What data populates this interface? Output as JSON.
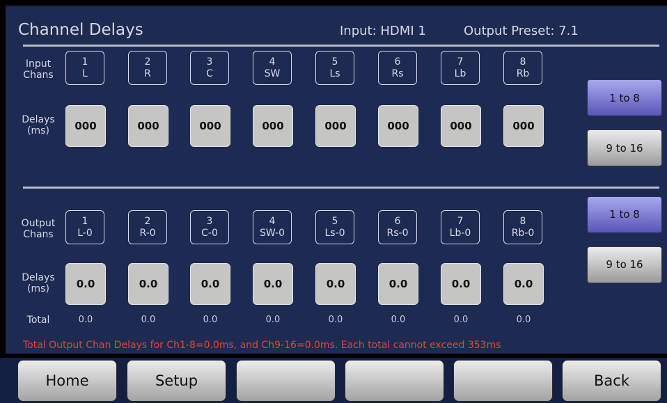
{
  "header": {
    "title": "Channel Delays",
    "input": "Input: HDMI 1",
    "output_preset": "Output Preset: 7.1"
  },
  "input_section": {
    "chans_label_1": "Input",
    "chans_label_2": "Chans",
    "delays_label_1": "Delays",
    "delays_label_2": "(ms)",
    "channels": [
      {
        "num": "1",
        "name": "L",
        "delay": "000"
      },
      {
        "num": "2",
        "name": "R",
        "delay": "000"
      },
      {
        "num": "3",
        "name": "C",
        "delay": "000"
      },
      {
        "num": "4",
        "name": "SW",
        "delay": "000"
      },
      {
        "num": "5",
        "name": "Ls",
        "delay": "000"
      },
      {
        "num": "6",
        "name": "Rs",
        "delay": "000"
      },
      {
        "num": "7",
        "name": "Lb",
        "delay": "000"
      },
      {
        "num": "8",
        "name": "Rb",
        "delay": "000"
      }
    ],
    "range_buttons": {
      "first": "1 to 8",
      "second": "9 to 16"
    }
  },
  "output_section": {
    "chans_label_1": "Output",
    "chans_label_2": "Chans",
    "delays_label_1": "Delays",
    "delays_label_2": "(ms)",
    "total_label": "Total",
    "channels": [
      {
        "num": "1",
        "name": "L-0",
        "delay": "0.0",
        "total": "0.0"
      },
      {
        "num": "2",
        "name": "R-0",
        "delay": "0.0",
        "total": "0.0"
      },
      {
        "num": "3",
        "name": "C-0",
        "delay": "0.0",
        "total": "0.0"
      },
      {
        "num": "4",
        "name": "SW-0",
        "delay": "0.0",
        "total": "0.0"
      },
      {
        "num": "5",
        "name": "Ls-0",
        "delay": "0.0",
        "total": "0.0"
      },
      {
        "num": "6",
        "name": "Rs-0",
        "delay": "0.0",
        "total": "0.0"
      },
      {
        "num": "7",
        "name": "Lb-0",
        "delay": "0.0",
        "total": "0.0"
      },
      {
        "num": "8",
        "name": "Rb-0",
        "delay": "0.0",
        "total": "0.0"
      }
    ],
    "range_buttons": {
      "first": "1 to 8",
      "second": "9 to 16"
    }
  },
  "warning": "Total Output Chan Delays for Ch1-8=0.0ms, and Ch9-16=0.0ms. Each total cannot exceed 353ms",
  "nav": {
    "home": "Home",
    "setup": "Setup",
    "blank1": "",
    "blank2": "",
    "blank3": "",
    "back": "Back"
  },
  "colors": {
    "panel": "#1d2a52",
    "accent_button": "#7b78d6",
    "warning": "#e0482c",
    "delay_box": "#c5c6c4"
  }
}
